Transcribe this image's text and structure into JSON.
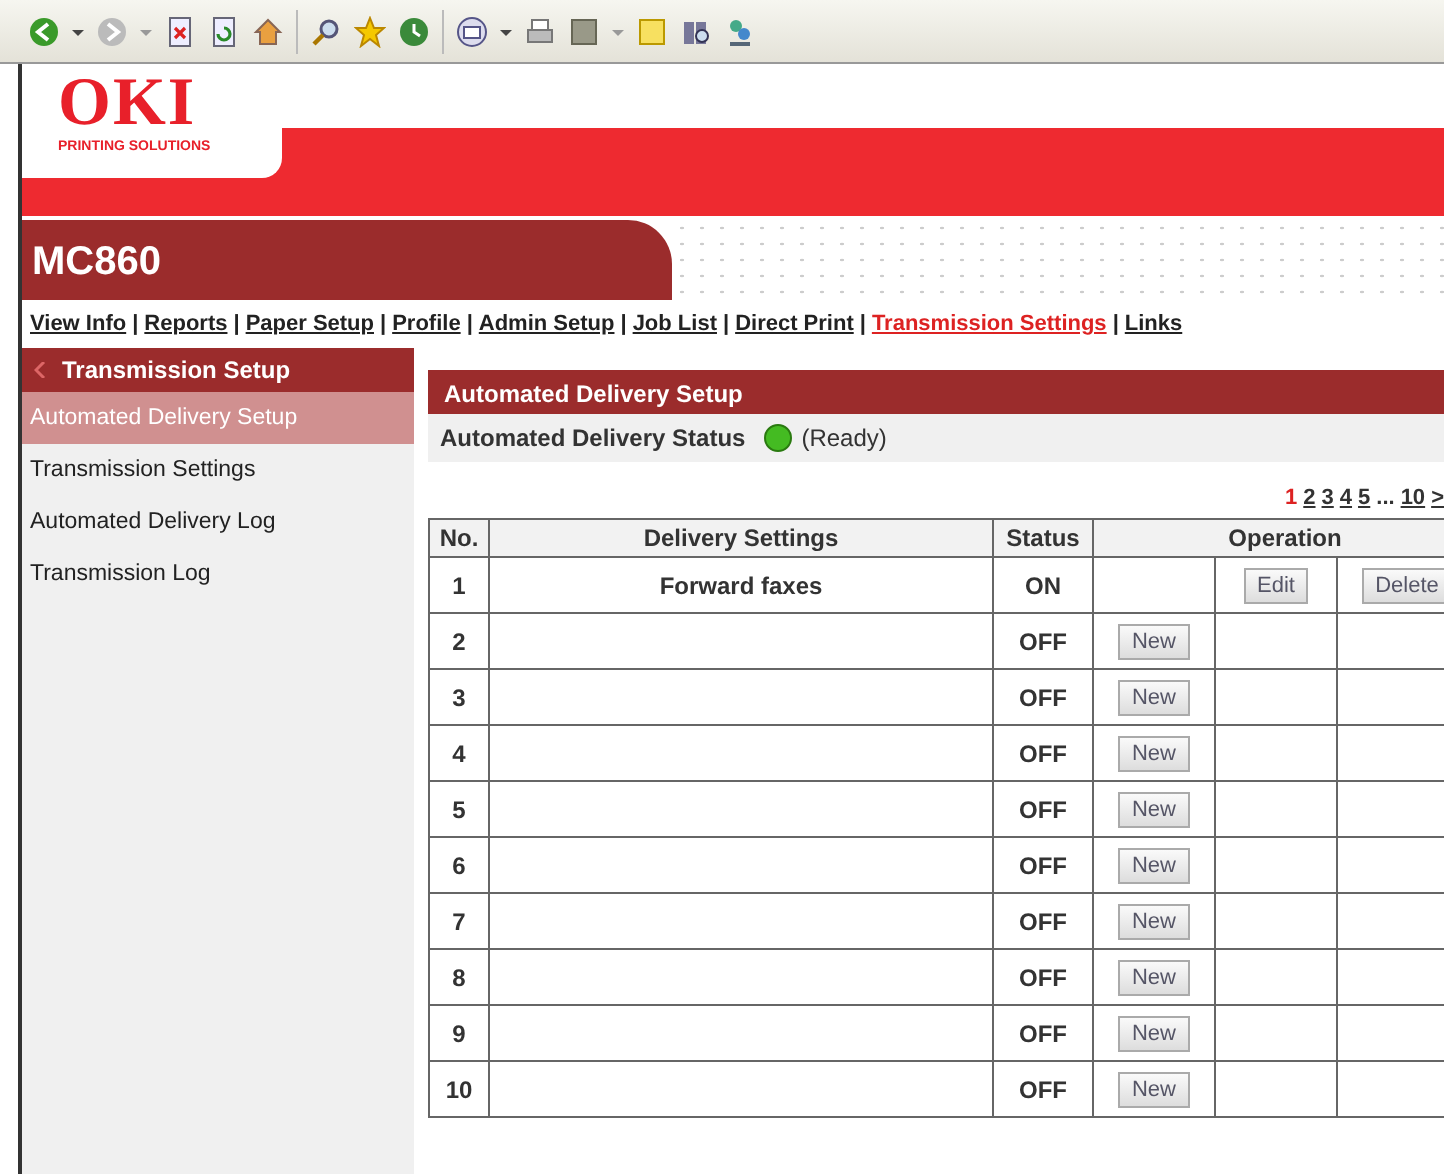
{
  "logo": {
    "name": "OKI",
    "tagline": "PRINTING SOLUTIONS"
  },
  "model": "MC860",
  "nav": [
    {
      "label": "View Info",
      "selected": false
    },
    {
      "label": "Reports",
      "selected": false
    },
    {
      "label": "Paper Setup",
      "selected": false
    },
    {
      "label": "Profile",
      "selected": false
    },
    {
      "label": "Admin Setup",
      "selected": false
    },
    {
      "label": "Job List",
      "selected": false
    },
    {
      "label": "Direct Print",
      "selected": false
    },
    {
      "label": "Transmission Settings",
      "selected": true
    },
    {
      "label": "Links",
      "selected": false
    }
  ],
  "nav_separator": "|",
  "sidebar": {
    "title": "Transmission Setup",
    "items": [
      {
        "label": "Automated Delivery Setup",
        "selected": true
      },
      {
        "label": "Transmission Settings",
        "selected": false
      },
      {
        "label": "Automated Delivery Log",
        "selected": false
      },
      {
        "label": "Transmission Log",
        "selected": false
      }
    ]
  },
  "panel": {
    "title": "Automated Delivery Setup",
    "status_label": "Automated Delivery Status",
    "ready": true,
    "status_text": "(Ready)"
  },
  "pagination": [
    {
      "kind": "page",
      "label": "1",
      "selected": true
    },
    {
      "kind": "page",
      "label": "2",
      "selected": false
    },
    {
      "kind": "page",
      "label": "3",
      "selected": false
    },
    {
      "kind": "page",
      "label": "4",
      "selected": false
    },
    {
      "kind": "page",
      "label": "5",
      "selected": false
    },
    {
      "kind": "ellipsis",
      "label": "..."
    },
    {
      "kind": "page",
      "label": "10",
      "selected": false
    },
    {
      "kind": "page",
      "label": ">",
      "selected": false
    }
  ],
  "table": {
    "columns": [
      "No.",
      "Delivery Settings",
      "Status",
      "Operation"
    ],
    "rows": [
      {
        "no": "1",
        "settings": "Forward faxes",
        "status": "ON",
        "edit_button": "Edit",
        "delete_button": "Delete"
      },
      {
        "no": "2",
        "status": "OFF",
        "new_button": "New"
      },
      {
        "no": "3",
        "status": "OFF",
        "new_button": "New"
      },
      {
        "no": "4",
        "status": "OFF",
        "new_button": "New"
      },
      {
        "no": "5",
        "status": "OFF",
        "new_button": "New"
      },
      {
        "no": "6",
        "status": "OFF",
        "new_button": "New"
      },
      {
        "no": "7",
        "status": "OFF",
        "new_button": "New"
      },
      {
        "no": "8",
        "status": "OFF",
        "new_button": "New"
      },
      {
        "no": "9",
        "status": "OFF",
        "new_button": "New"
      },
      {
        "no": "10",
        "status": "OFF",
        "new_button": "New"
      }
    ]
  }
}
